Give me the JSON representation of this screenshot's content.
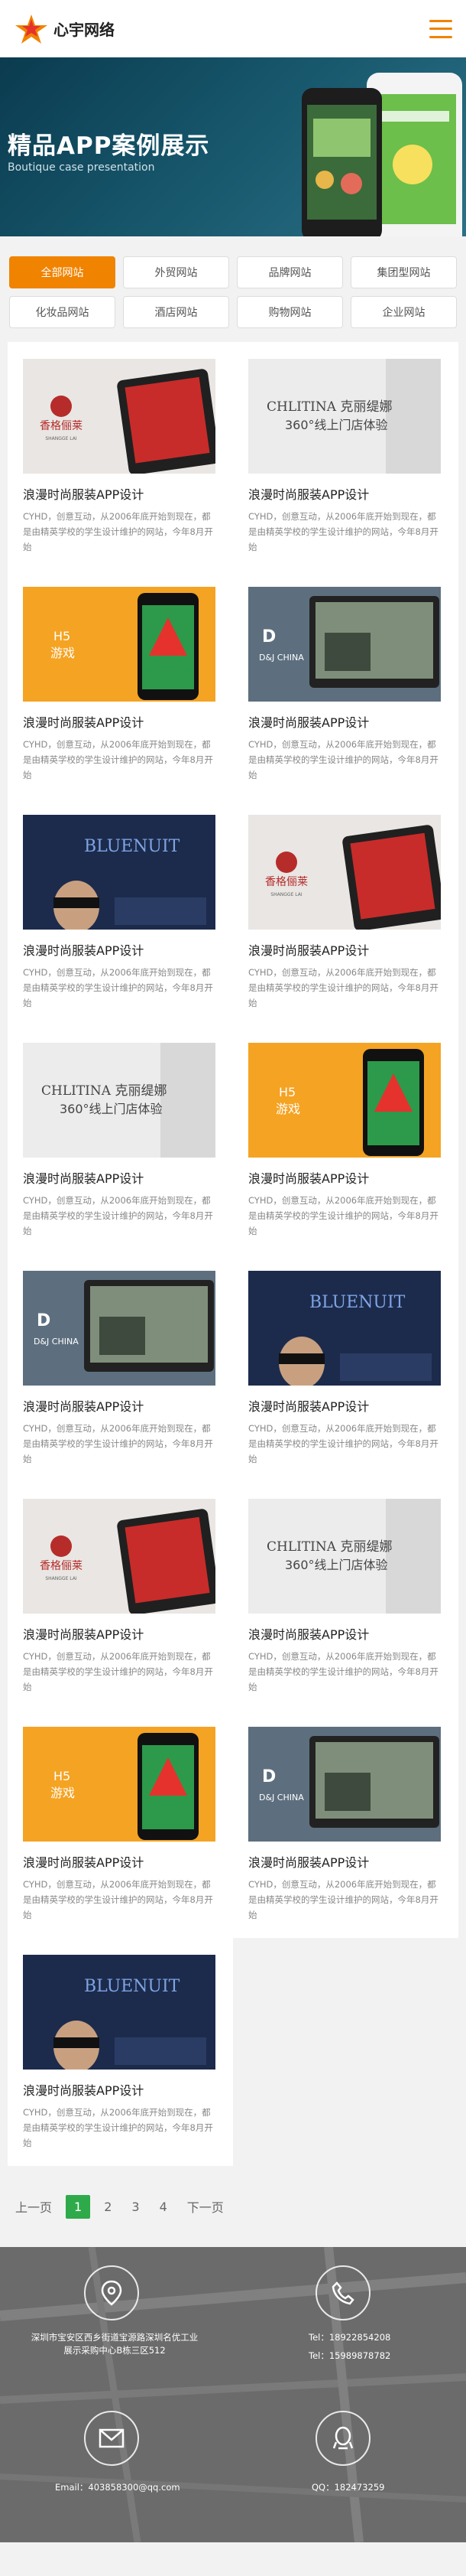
{
  "header": {
    "logo_text": "心宇网络",
    "logo_icon": "star-logo-icon",
    "menu_icon": "hamburger-menu-icon"
  },
  "banner": {
    "title": "精品APP案例展示",
    "subtitle": "Boutique case presentation"
  },
  "filters": [
    "全部网站",
    "外贸网站",
    "品牌网站",
    "集团型网站",
    "化妆品网站",
    "酒店网站",
    "购物网站",
    "企业网站"
  ],
  "active_filter": "全部网站",
  "cases": [
    {
      "title": "浪漫时尚服装APP设计",
      "desc": "CYHD，创意互动，从2006年底开始到现在，都是由精英学校的学生设计维护的网站，今年8月开始",
      "brand": "香格俪莱",
      "brand_sub": "SHANGGE LAI",
      "thumb": "xiangge"
    },
    {
      "title": "浪漫时尚服装APP设计",
      "desc": "CYHD，创意互动，从2006年底开始到现在，都是由精英学校的学生设计维护的网站，今年8月开始",
      "brand": "CHLITINA 克丽缇娜",
      "brand_sub": "360°线上门店体验",
      "thumb": "chlitina"
    },
    {
      "title": "浪漫时尚服装APP设计",
      "desc": "CYHD，创意互动，从2006年底开始到现在，都是由精英学校的学生设计维护的网站，今年8月开始",
      "brand": "H5 游戏",
      "brand_sub": "",
      "thumb": "h5"
    },
    {
      "title": "浪漫时尚服装APP设计",
      "desc": "CYHD，创意互动，从2006年底开始到现在，都是由精英学校的学生设计维护的网站，今年8月开始",
      "brand": "D&J CHINA",
      "brand_sub": "",
      "thumb": "dj"
    },
    {
      "title": "浪漫时尚服装APP设计",
      "desc": "CYHD，创意互动，从2006年底开始到现在，都是由精英学校的学生设计维护的网站，今年8月开始",
      "brand": "BLUENUIT",
      "brand_sub": "",
      "thumb": "bluenuit"
    },
    {
      "title": "浪漫时尚服装APP设计",
      "desc": "CYHD，创意互动，从2006年底开始到现在，都是由精英学校的学生设计维护的网站，今年8月开始",
      "brand": "香格俪莱",
      "brand_sub": "SHANGGE LAI",
      "thumb": "xiangge"
    },
    {
      "title": "浪漫时尚服装APP设计",
      "desc": "CYHD，创意互动，从2006年底开始到现在，都是由精英学校的学生设计维护的网站，今年8月开始",
      "brand": "CHLITINA 克丽缇娜",
      "brand_sub": "360°线上门店体验",
      "thumb": "chlitina"
    },
    {
      "title": "浪漫时尚服装APP设计",
      "desc": "CYHD，创意互动，从2006年底开始到现在，都是由精英学校的学生设计维护的网站，今年8月开始",
      "brand": "H5 游戏",
      "brand_sub": "",
      "thumb": "h5"
    },
    {
      "title": "浪漫时尚服装APP设计",
      "desc": "CYHD，创意互动，从2006年底开始到现在，都是由精英学校的学生设计维护的网站，今年8月开始",
      "brand": "D&J CHINA",
      "brand_sub": "",
      "thumb": "dj"
    },
    {
      "title": "浪漫时尚服装APP设计",
      "desc": "CYHD，创意互动，从2006年底开始到现在，都是由精英学校的学生设计维护的网站，今年8月开始",
      "brand": "BLUENUIT",
      "brand_sub": "",
      "thumb": "bluenuit"
    },
    {
      "title": "浪漫时尚服装APP设计",
      "desc": "CYHD，创意互动，从2006年底开始到现在，都是由精英学校的学生设计维护的网站，今年8月开始",
      "brand": "香格俪莱",
      "brand_sub": "SHANGGE LAI",
      "thumb": "xiangge"
    },
    {
      "title": "浪漫时尚服装APP设计",
      "desc": "CYHD，创意互动，从2006年底开始到现在，都是由精英学校的学生设计维护的网站，今年8月开始",
      "brand": "CHLITINA 克丽缇娜",
      "brand_sub": "360°线上门店体验",
      "thumb": "chlitina"
    },
    {
      "title": "浪漫时尚服装APP设计",
      "desc": "CYHD，创意互动，从2006年底开始到现在，都是由精英学校的学生设计维护的网站，今年8月开始",
      "brand": "H5 游戏",
      "brand_sub": "",
      "thumb": "h5"
    },
    {
      "title": "浪漫时尚服装APP设计",
      "desc": "CYHD，创意互动，从2006年底开始到现在，都是由精英学校的学生设计维护的网站，今年8月开始",
      "brand": "D&J CHINA",
      "brand_sub": "",
      "thumb": "dj"
    },
    {
      "title": "浪漫时尚服装APP设计",
      "desc": "CYHD，创意互动，从2006年底开始到现在，都是由精英学校的学生设计维护的网站，今年8月开始",
      "brand": "BLUENUIT",
      "brand_sub": "",
      "thumb": "bluenuit"
    }
  ],
  "pagination": {
    "prev": "上一页",
    "pages": [
      "1",
      "2",
      "3",
      "4"
    ],
    "current": "1",
    "next": "下一页"
  },
  "footer": {
    "address": "深圳市宝安区西乡街道宝源路深圳名优工业展示采购中心B栋三区512",
    "tel1": "Tel：18922854208",
    "tel2": "Tel：15989878782",
    "email": "Email：403858300@qq.com",
    "qq": "QQ：182473259",
    "icons": [
      "location-icon",
      "phone-icon",
      "mail-icon",
      "qq-icon"
    ]
  },
  "colors": {
    "accent": "#f08300",
    "pager": "#2eaa4a",
    "banner": "#16556a"
  }
}
